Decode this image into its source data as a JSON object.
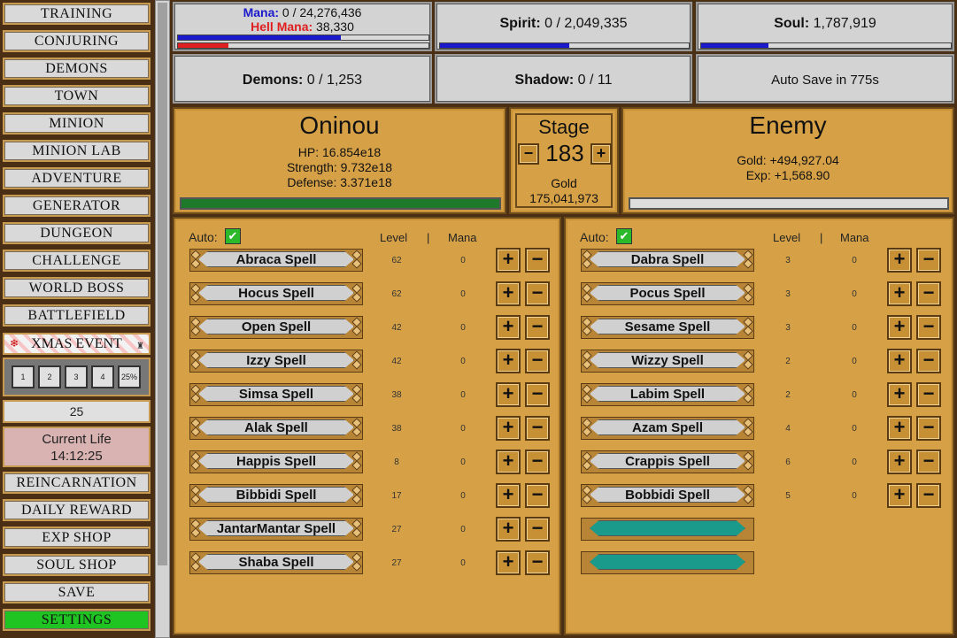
{
  "nav": {
    "training": "TRAINING",
    "conjuring": "CONJURING",
    "demons": "DEMONS",
    "town": "TOWN",
    "minion": "MINION",
    "minion_lab": "MINION LAB",
    "adventure": "ADVENTURE",
    "generator": "GENERATOR",
    "dungeon": "DUNGEON",
    "challenge": "CHALLENGE",
    "world_boss": "WORLD BOSS",
    "battlefield": "BATTLEFIELD",
    "xmas_event": "XMAS EVENT",
    "reincarnation": "REINCARNATION",
    "daily_reward": "DAILY REWARD",
    "exp_shop": "EXP SHOP",
    "soul_shop": "SOUL SHOP",
    "save": "SAVE",
    "settings": "SETTINGS"
  },
  "speed": {
    "b1": "1",
    "b2": "2",
    "b3": "3",
    "b4": "4",
    "b5": "25%"
  },
  "number_box": "25",
  "life": {
    "label": "Current Life",
    "time": "14:12:25"
  },
  "stats": {
    "mana_label": "Mana:",
    "mana_value": " 0 / 24,276,436",
    "hell_mana_label": "Hell Mana:",
    "hell_mana_value": " 38,330",
    "spirit_label": "Spirit:",
    "spirit_value": " 0 / 2,049,335",
    "soul_label": "Soul:",
    "soul_value": " 1,787,919",
    "demons_label": "Demons:",
    "demons_value": " 0 / 1,253",
    "shadow_label": "Shadow:",
    "shadow_value": " 0 / 11",
    "autosave": "Auto Save in 775s",
    "mana_fill": 0.65,
    "hell_mana_fill": 0.2,
    "spirit_fill": 0.52,
    "soul_fill": 0.27
  },
  "player": {
    "name": "Oninou",
    "hp": "HP: 16.854e18",
    "strength": "Strength: 9.732e18",
    "defense": "Defense: 3.371e18",
    "hp_fill": 1.0
  },
  "stage": {
    "title": "Stage",
    "value": "183",
    "gold_label": "Gold",
    "gold_value": "175,041,973",
    "minus": "−",
    "plus": "+"
  },
  "enemy": {
    "title": "Enemy",
    "gold": "Gold: +494,927.04",
    "exp": "Exp: +1,568.90"
  },
  "colors": {
    "mana": "#1a1acc",
    "hell_mana": "#e02020",
    "hp": "#1e7a2a",
    "accent_panel": "#d6a146"
  },
  "left_spells": {
    "auto": "Auto:",
    "level_hdr": "Level",
    "sep": "|",
    "mana_hdr": "Mana",
    "items": [
      {
        "name": "Abraca Spell",
        "level": "62",
        "mana": "0"
      },
      {
        "name": "Hocus Spell",
        "level": "62",
        "mana": "0"
      },
      {
        "name": "Open Spell",
        "level": "42",
        "mana": "0"
      },
      {
        "name": "Izzy Spell",
        "level": "42",
        "mana": "0"
      },
      {
        "name": "Simsa Spell",
        "level": "38",
        "mana": "0"
      },
      {
        "name": "Alak Spell",
        "level": "38",
        "mana": "0"
      },
      {
        "name": "Happis Spell",
        "level": "8",
        "mana": "0"
      },
      {
        "name": "Bibbidi Spell",
        "level": "17",
        "mana": "0"
      },
      {
        "name": "JantarMantar Spell",
        "level": "27",
        "mana": "0"
      },
      {
        "name": "Shaba Spell",
        "level": "27",
        "mana": "0"
      }
    ]
  },
  "right_spells": {
    "auto": "Auto:",
    "level_hdr": "Level",
    "sep": "|",
    "mana_hdr": "Mana",
    "items": [
      {
        "name": "Dabra Spell",
        "level": "3",
        "mana": "0"
      },
      {
        "name": "Pocus Spell",
        "level": "3",
        "mana": "0"
      },
      {
        "name": "Sesame Spell",
        "level": "3",
        "mana": "0"
      },
      {
        "name": "Wizzy Spell",
        "level": "2",
        "mana": "0"
      },
      {
        "name": "Labim Spell",
        "level": "2",
        "mana": "0"
      },
      {
        "name": "Azam Spell",
        "level": "4",
        "mana": "0"
      },
      {
        "name": "Crappis Spell",
        "level": "6",
        "mana": "0"
      },
      {
        "name": "Bobbidi Spell",
        "level": "5",
        "mana": "0"
      }
    ]
  }
}
